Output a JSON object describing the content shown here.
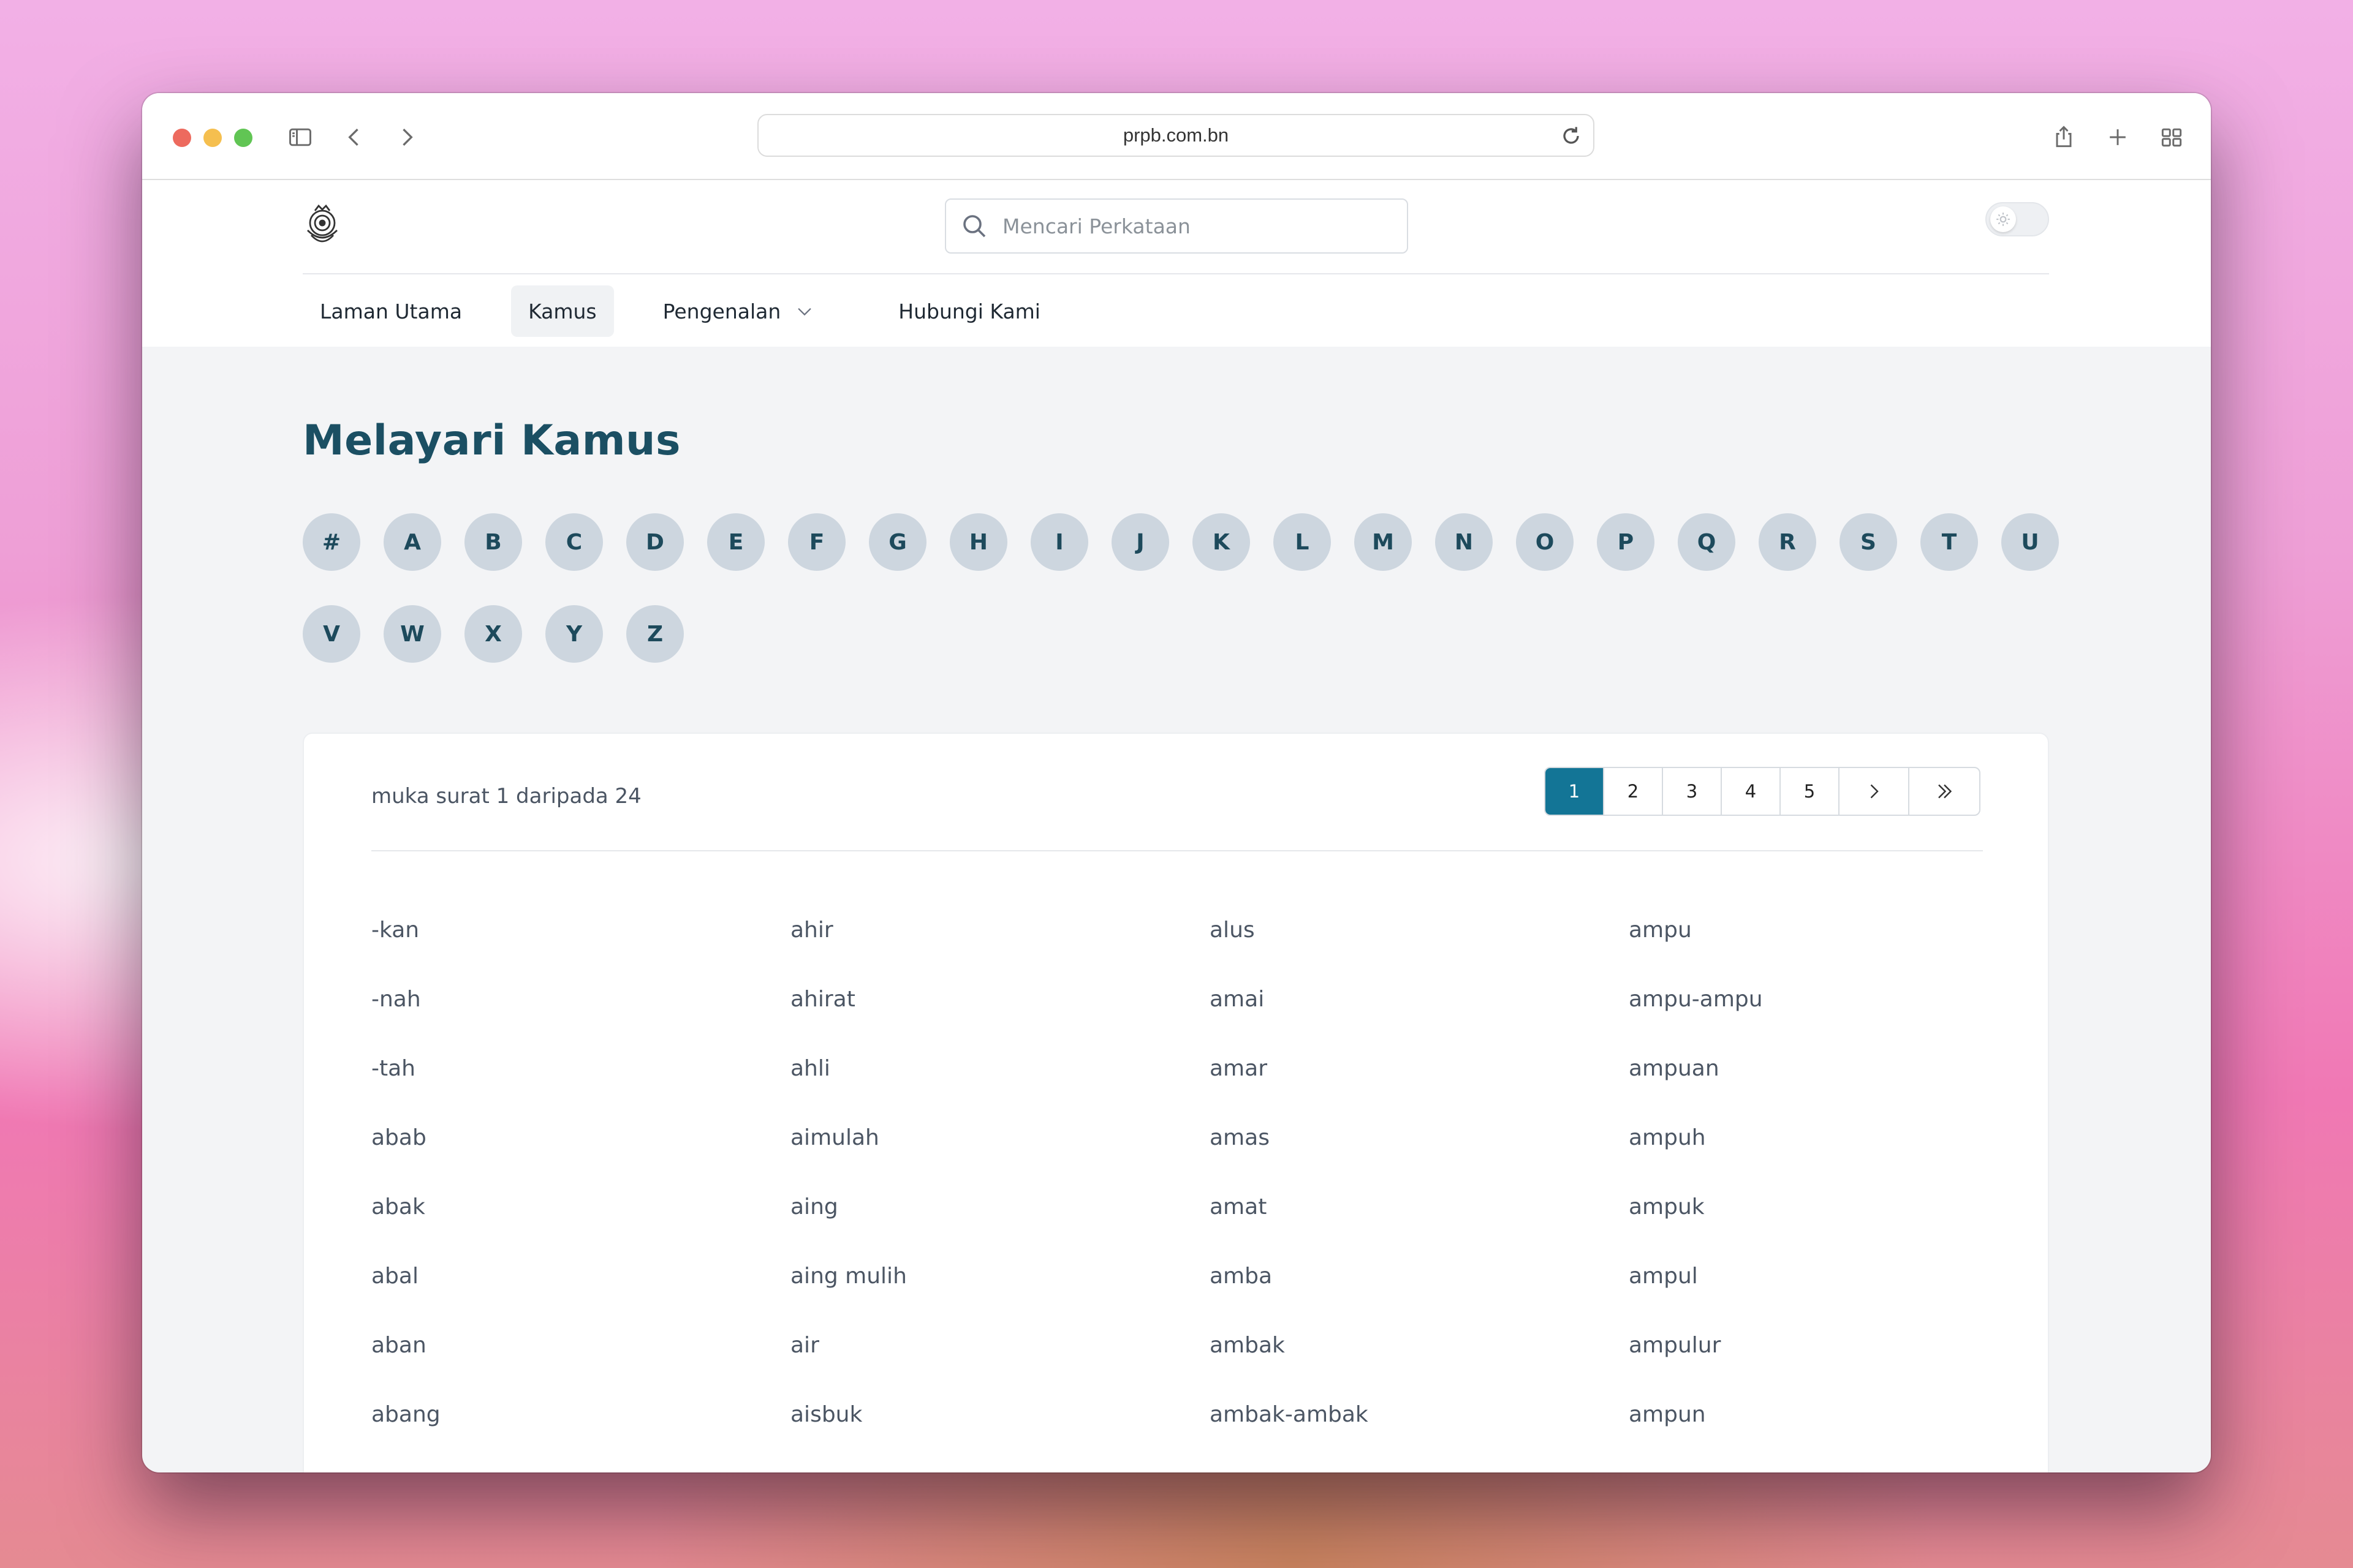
{
  "browser": {
    "url": "prpb.com.bn"
  },
  "header": {
    "search_placeholder": "Mencari Perkataan",
    "nav": [
      {
        "label": "Laman Utama",
        "active": false
      },
      {
        "label": "Kamus",
        "active": true
      },
      {
        "label": "Pengenalan",
        "active": false,
        "has_dropdown": true
      },
      {
        "label": "Hubungi Kami",
        "active": false
      }
    ]
  },
  "main": {
    "title": "Melayari Kamus",
    "letters": [
      "#",
      "A",
      "B",
      "C",
      "D",
      "E",
      "F",
      "G",
      "H",
      "I",
      "J",
      "K",
      "L",
      "M",
      "N",
      "O",
      "P",
      "Q",
      "R",
      "S",
      "T",
      "U",
      "V",
      "W",
      "X",
      "Y",
      "Z"
    ],
    "page_info": "muka surat 1 daripada 24",
    "pagination": {
      "pages": [
        "1",
        "2",
        "3",
        "4",
        "5"
      ],
      "current": "1"
    },
    "words": [
      [
        "-kan",
        "-nah",
        "-tah",
        "abab",
        "abak",
        "abal",
        "aban",
        "abang"
      ],
      [
        "ahir",
        "ahirat",
        "ahli",
        "aimulah",
        "aing",
        "aing mulih",
        "air",
        "aisbuk"
      ],
      [
        "alus",
        "amai",
        "amar",
        "amas",
        "amat",
        "amba",
        "ambak",
        "ambak-ambak"
      ],
      [
        "ampu",
        "ampu-ampu",
        "ampuan",
        "ampuh",
        "ampuk",
        "ampul",
        "ampulur",
        "ampun"
      ]
    ]
  },
  "colors": {
    "title": "#1b4f63",
    "letter_bg": "#cdd6df",
    "pager_active": "#137596"
  }
}
